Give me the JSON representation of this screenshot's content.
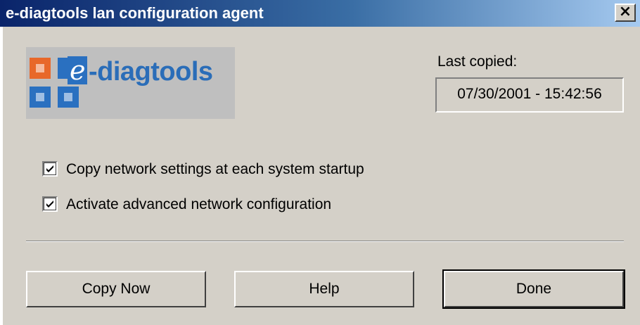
{
  "window": {
    "title": "e-diagtools lan configuration agent",
    "close_label": "×"
  },
  "logo": {
    "e_letter": "e",
    "text": "-diagtools",
    "colors": {
      "orange": "#e8682a",
      "blue": "#2a70c0",
      "text": "#2a6db8"
    }
  },
  "last_copied": {
    "label": "Last copied:",
    "value": "07/30/2001 - 15:42:56"
  },
  "options": [
    {
      "label": "Copy network settings at each system startup",
      "checked": true
    },
    {
      "label": "Activate advanced network configuration",
      "checked": true
    }
  ],
  "buttons": {
    "copy_now": "Copy Now",
    "help": "Help",
    "done": "Done"
  }
}
